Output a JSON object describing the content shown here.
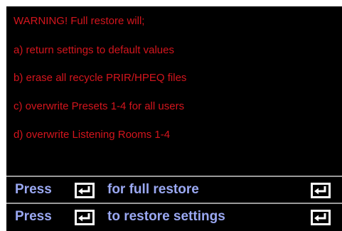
{
  "warning": {
    "title": "WARNING! Full restore will;",
    "items": [
      "a) return settings to default values",
      "b) erase all recycle PRIR/HPEQ files",
      "c) overwrite Presets 1-4 for all users",
      "d) overwrite Listening Rooms 1-4"
    ]
  },
  "menu": {
    "items": [
      {
        "prefix": "Press",
        "suffix": "for full restore",
        "icon": "enter-key-icon"
      },
      {
        "prefix": "Press",
        "suffix": "to restore settings",
        "icon": "enter-key-icon"
      }
    ]
  },
  "colors": {
    "background": "#000000",
    "warning_text": "#d4151d",
    "menu_text": "#9aa8f2",
    "divider": "#9a9a9a"
  }
}
